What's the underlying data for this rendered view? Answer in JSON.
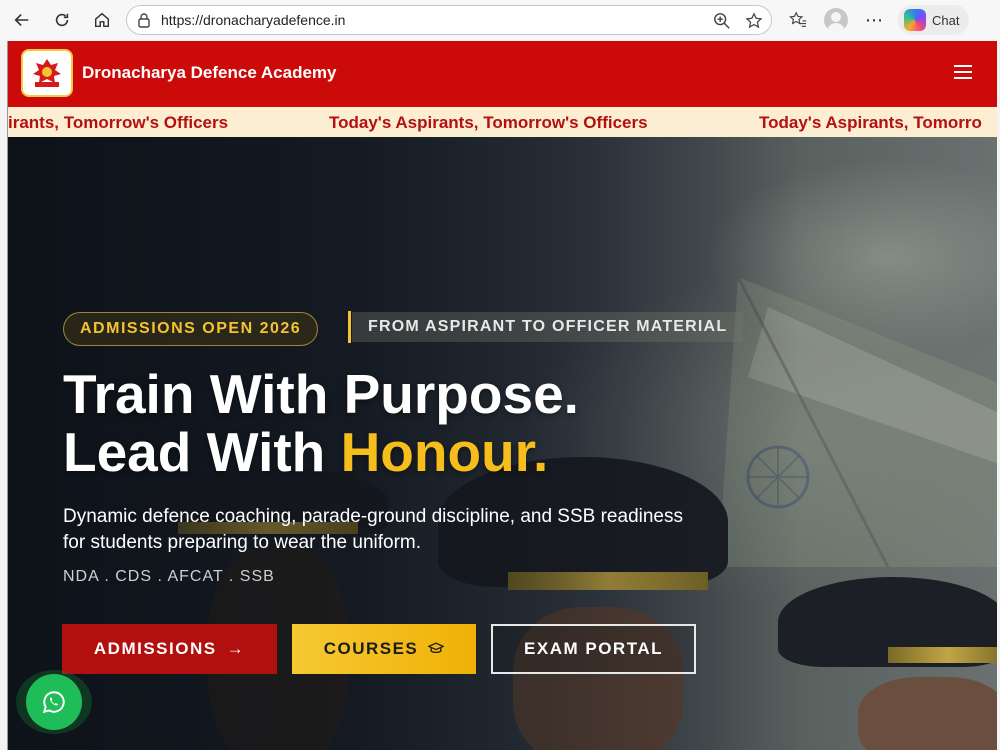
{
  "browser": {
    "url": "https://dronacharyadefence.in",
    "chat_label": "Chat",
    "icons": [
      "back-icon",
      "refresh-icon",
      "home-icon",
      "lock-icon",
      "zoom-icon",
      "favorite-star-icon",
      "favorites-list-icon",
      "profile-icon",
      "more-icon",
      "copilot-icon"
    ]
  },
  "header": {
    "brand": "Dronacharya Defence Academy",
    "brand_color": "#cc0a0a"
  },
  "ticker": {
    "items": [
      "irants, Tomorrow's Officers",
      "Today's Aspirants, Tomorrow's Officers",
      "Today's Aspirants, Tomorro"
    ]
  },
  "hero": {
    "badge": "ADMISSIONS OPEN 2026",
    "tagline": "FROM ASPIRANT TO OFFICER MATERIAL",
    "headline_line1": "Train With Purpose.",
    "headline_line2_prefix": "Lead With ",
    "headline_line2_accent": "Honour.",
    "accent_color": "#f5be1c",
    "subtext": "Dynamic defence coaching, parade-ground discipline, and SSB readiness for students preparing to wear the uniform.",
    "exams": "NDA . CDS . AFCAT . SSB"
  },
  "buttons": {
    "admissions": "ADMISSIONS",
    "courses": "COURSES",
    "portal": "EXAM PORTAL"
  }
}
